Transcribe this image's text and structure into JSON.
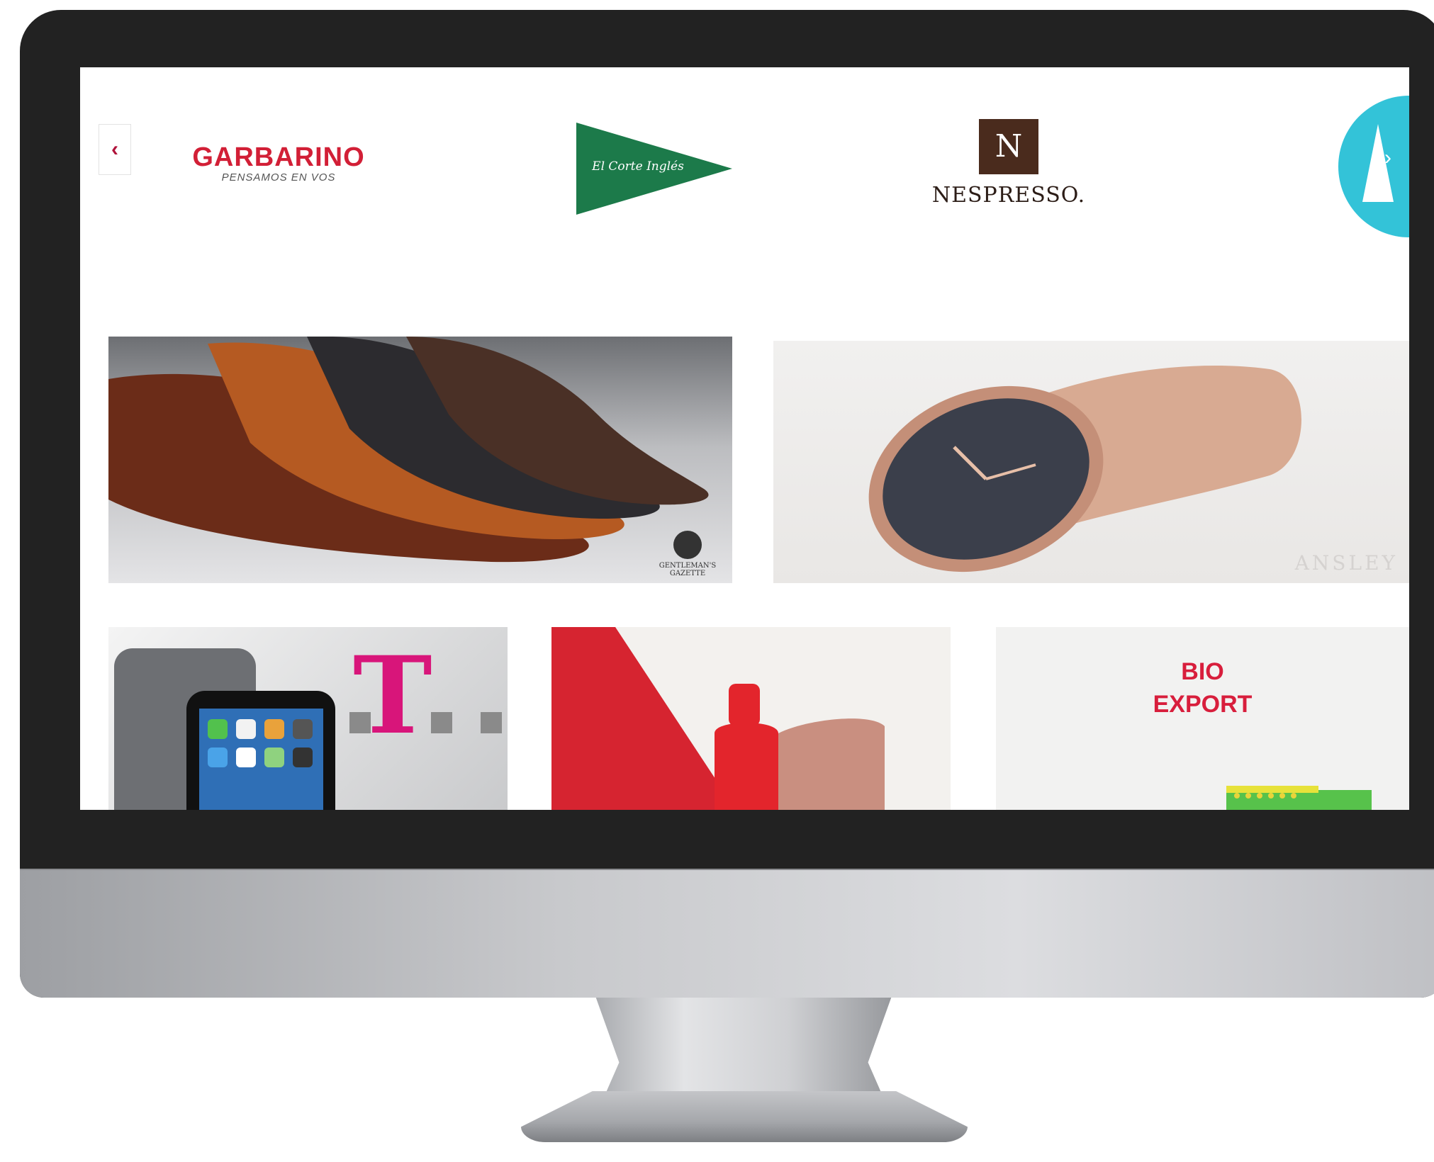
{
  "carousel": {
    "prev_label": "‹",
    "next_label": "›",
    "brands": [
      {
        "name": "GARBARINO",
        "tagline": "PENSAMOS EN VOS",
        "color": "#d21f36"
      },
      {
        "name": "El Corte Inglés",
        "color": "#1c7a4a"
      },
      {
        "name": "NESPRESSO.",
        "monogram": "N",
        "color": "#4a2b1d"
      },
      {
        "name": "",
        "color": "#33c3d8"
      }
    ]
  },
  "tiles": {
    "shoes": {
      "watermark": "GENTLEMAN'S GAZETTE"
    },
    "watch": {
      "watermark": "ANSLEY"
    },
    "phone": {
      "logo": "T",
      "logo_color": "#d8157a"
    },
    "bottle": {},
    "bio": {
      "label": "BIO\nEXPORT",
      "color": "#d81e3c"
    }
  }
}
